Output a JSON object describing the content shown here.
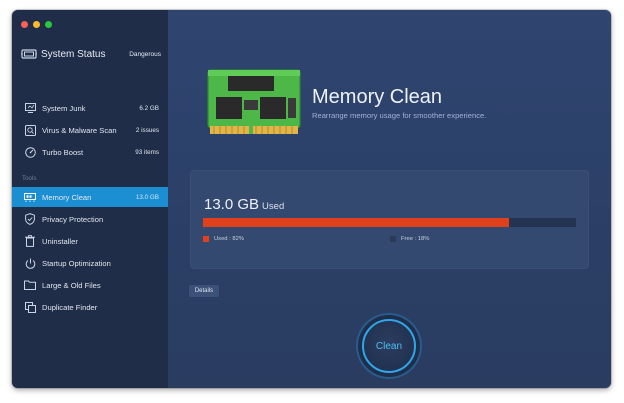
{
  "sidebar": {
    "status_title": "System Status",
    "status_value": "Dangerous",
    "scan_items": [
      {
        "label": "System Junk",
        "value": "6.2 GB",
        "icon": "monitor-icon"
      },
      {
        "label": "Virus & Malware Scan",
        "value": "2 issues",
        "icon": "shield-scan-icon"
      },
      {
        "label": "Turbo Boost",
        "value": "93 items",
        "icon": "speedometer-icon"
      }
    ],
    "tools_label": "Tools",
    "tools": [
      {
        "label": "Memory Clean",
        "value": "13.0 GB",
        "icon": "memory-icon",
        "active": true
      },
      {
        "label": "Privacy Protection",
        "value": "",
        "icon": "shield-check-icon"
      },
      {
        "label": "Uninstaller",
        "value": "",
        "icon": "trash-icon"
      },
      {
        "label": "Startup Optimization",
        "value": "",
        "icon": "power-icon"
      },
      {
        "label": "Large & Old Files",
        "value": "",
        "icon": "folder-icon"
      },
      {
        "label": "Duplicate Finder",
        "value": "",
        "icon": "copy-icon"
      }
    ]
  },
  "main": {
    "title": "Memory Clean",
    "subtitle": "Rearrange memory usage for smoother experience.",
    "used_value": "13.0 GB",
    "used_label": "Used",
    "used_percent": 82,
    "legend_used": "Used : 82%",
    "legend_free": "Free : 18%",
    "details_label": "Details",
    "clean_label": "Clean"
  },
  "colors": {
    "accent": "#1c8fd3",
    "used": "#e0401c",
    "free": "#24334f",
    "clean_ring": "#2fa6e8"
  }
}
